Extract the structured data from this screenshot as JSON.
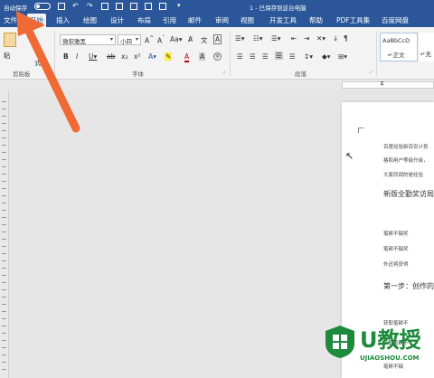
{
  "titlebar": {
    "autosave_label": "自动保存",
    "doc_title": "1 - 已保存到这台电脑",
    "bg": "#2b579a"
  },
  "tabs": [
    "文件",
    "开始",
    "插入",
    "绘图",
    "设计",
    "布局",
    "引用",
    "邮件",
    "审阅",
    "视图",
    "开发工具",
    "帮助",
    "PDF工具集",
    "百度网盘"
  ],
  "ribbon": {
    "paste_label": "粘",
    "format_painter_label": "式刷",
    "clipboard_label": "剪贴板",
    "font_name": "微软雅黑",
    "font_size": "小四",
    "font_group_label": "字体",
    "paragraph_group_label": "段落",
    "style_normal_preview": "AaBbCcD",
    "style_normal_label": "↵正文",
    "style_nospace_label": "↵无"
  },
  "document": {
    "line1": "百度经验新百安计划",
    "line2": "格和用户等级升级，",
    "line3": "大家同调的是经验",
    "heading1": "新版全勤奖访局",
    "line4": "笔耕不辍奖",
    "line5": "笔耕不辍奖",
    "line6": "外还将获得",
    "heading2": "第一步：创作的",
    "line7": "获取笔耕不",
    "line8": "获取笔耕不",
    "line9": "笔耕不辍"
  },
  "watermark": {
    "brand": "U教授",
    "url": "UJIAOSHOU.COM",
    "color": "#1e8a3c"
  },
  "arrow_color": "#f06a35"
}
